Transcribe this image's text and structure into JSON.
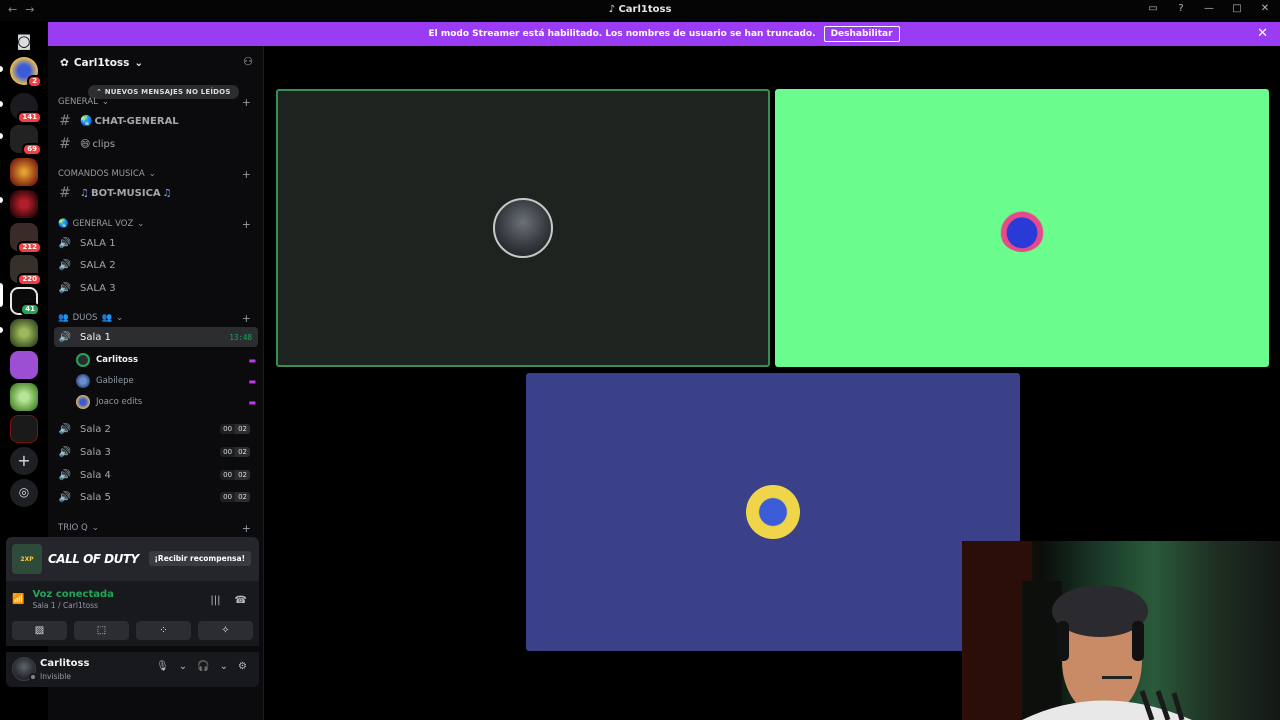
{
  "window": {
    "title": "Carl1toss"
  },
  "banner": {
    "text": "El modo Streamer está habilitado. Los nombres de usuario se han truncado.",
    "button": "Deshabilitar"
  },
  "guild": {
    "name": "Carl1toss",
    "unread_pill": "NUEVOS MENSAJES NO LEÍDOS"
  },
  "rail": {
    "badges": [
      "2",
      "141",
      "69",
      "212",
      "220",
      "41"
    ]
  },
  "categories": {
    "general": "GENERAL",
    "comandos": "COMANDOS MUSICA",
    "general_voz": "GENERAL VOZ",
    "duos": "DUOS",
    "trio": "TRIO Q"
  },
  "text_channels": {
    "chat_general": "CHAT-GENERAL",
    "clips": "clips",
    "bot_musica": "BOT-MUSICA"
  },
  "voice_channels": {
    "sala1": "SALA 1",
    "sala2": "SALA 2",
    "sala3": "SALA 3"
  },
  "duos_channels": [
    {
      "name": "Sala 1",
      "time": "13:48"
    },
    {
      "name": "Sala 2",
      "count_a": "00",
      "count_b": "02"
    },
    {
      "name": "Sala 3",
      "count_a": "00",
      "count_b": "02"
    },
    {
      "name": "Sala 4",
      "count_a": "00",
      "count_b": "02"
    },
    {
      "name": "Sala 5",
      "count_a": "00",
      "count_b": "02"
    }
  ],
  "members": [
    "Carlitoss",
    "Gabilepe",
    "Joaco edits"
  ],
  "promo": {
    "game": "CALL OF DUTY",
    "claim": "¡Recibir recompensa!"
  },
  "voice": {
    "title": "Voz conectada",
    "subtitle": "Sala 1 / Carl1toss"
  },
  "user": {
    "name": "Carlitoss",
    "status": "Invisible"
  },
  "colors": {
    "banner": "#9b3cf5",
    "tile1": "#1d231f",
    "tile2": "#6afc8c",
    "tile3": "#3a4189",
    "connected": "#23a55a"
  }
}
